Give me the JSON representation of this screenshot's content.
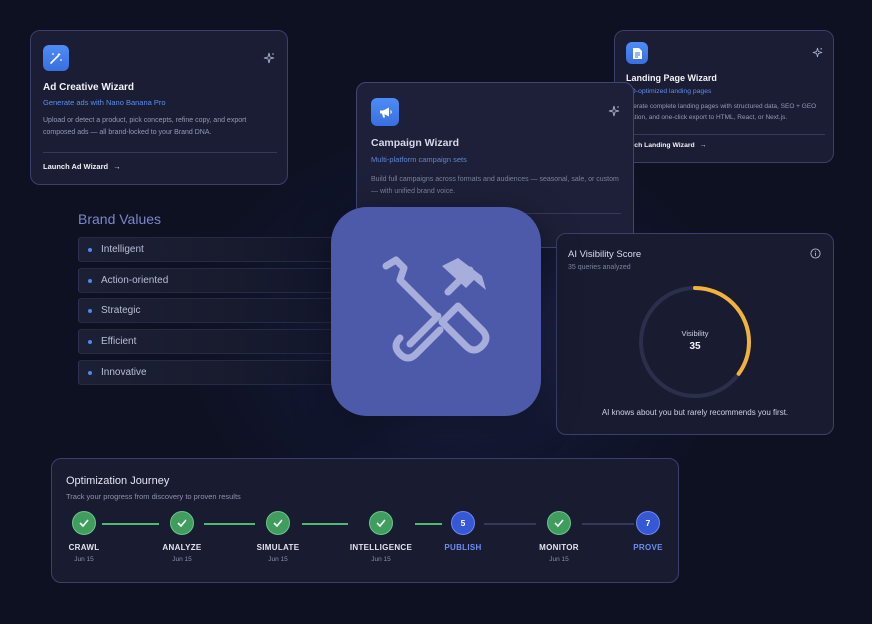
{
  "ad_wizard": {
    "title": "Ad Creative Wizard",
    "subtitle": "Generate ads with Nano Banana Pro",
    "description": "Upload or detect a product, pick concepts, refine copy, and export composed ads — all brand-locked to your Brand DNA.",
    "launch": "Launch Ad Wizard",
    "icon": "magic-wand-icon"
  },
  "campaign_wizard": {
    "title": "Campaign Wizard",
    "subtitle": "Multi-platform campaign sets",
    "description": "Build full campaigns across formats and audiences — seasonal, sale, or custom — with unified brand voice.",
    "icon": "megaphone-icon"
  },
  "landing_wizard": {
    "title": "Landing Page Wizard",
    "subtitle": "EO-optimized landing pages",
    "description": "enerate complete landing pages with structured data, SEO + GEO idation, and one-click export to HTML, React, or Next.js.",
    "launch": "unch Landing Wizard",
    "icon": "document-icon"
  },
  "brand_values": {
    "title": "Brand Values",
    "items": [
      "Intelligent",
      "Action-oriented",
      "Strategic",
      "Efficient",
      "Innovative"
    ]
  },
  "visibility": {
    "title": "AI Visibility Score",
    "subtitle": "35 queries analyzed",
    "gauge_label": "Visibility",
    "score": "35",
    "score_value": 35,
    "footer": "AI knows about you but rarely recommends you first.",
    "accent": "#f2b33d"
  },
  "journey": {
    "title": "Optimization Journey",
    "subtitle": "Track your progress from discovery to proven results",
    "steps": [
      {
        "label": "CRAWL",
        "date": "Jun 15",
        "status": "done"
      },
      {
        "label": "ANALYZE",
        "date": "Jun 15",
        "status": "done"
      },
      {
        "label": "SIMULATE",
        "date": "Jun 15",
        "status": "done"
      },
      {
        "label": "INTELLIGENCE",
        "date": "Jun 15",
        "status": "done"
      },
      {
        "label": "PUBLISH",
        "number": "5",
        "status": "todo"
      },
      {
        "label": "MONITOR",
        "date": "Jun 15",
        "status": "done"
      },
      {
        "label": "PROVE",
        "number": "7",
        "status": "todo"
      }
    ]
  },
  "colors": {
    "background": "#0e1122",
    "card": "#1a1d33",
    "accent_blue": "#4d8cf6",
    "tile": "#4d5aa9",
    "success": "#3f9e5e"
  }
}
